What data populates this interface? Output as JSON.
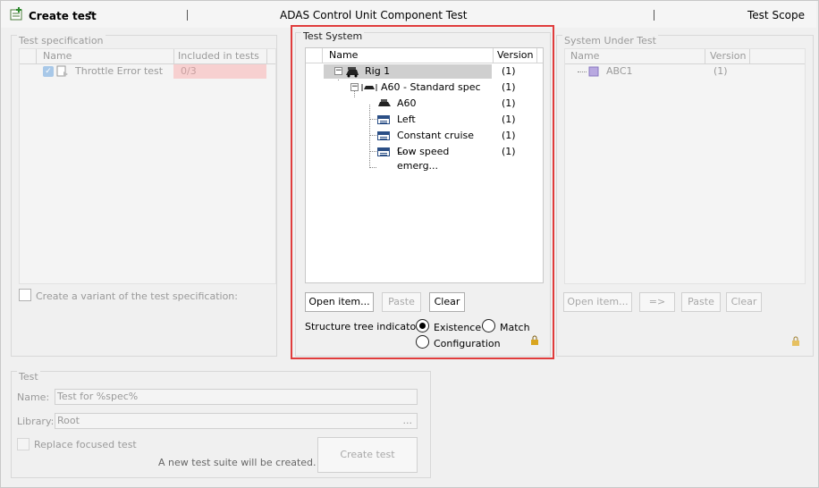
{
  "toolbar": {
    "create_test_label": "Create test",
    "title": "ADAS Control Unit Component Test",
    "scope_label": "Test Scope",
    "separator": "|"
  },
  "test_spec": {
    "title": "Test specification",
    "columns": [
      "Name",
      "Included in tests"
    ],
    "rows": [
      {
        "name": "Throttle Error test",
        "included": "0/3"
      }
    ],
    "variant_label": "Create a variant of the test specification:"
  },
  "test_system": {
    "title": "Test System",
    "columns": [
      "Name",
      "Version"
    ],
    "tree": [
      {
        "label": "Rig 1",
        "version": "(1)"
      },
      {
        "label": "A60 - Standard spec",
        "version": "(1)"
      },
      {
        "label": "A60",
        "version": "(1)"
      },
      {
        "label": "Left",
        "version": "(1)"
      },
      {
        "label": "Constant cruise c...",
        "version": "(1)"
      },
      {
        "label": "Low speed emerg...",
        "version": "(1)"
      }
    ],
    "buttons": {
      "open": "Open item...",
      "paste": "Paste",
      "clear": "Clear"
    },
    "indicator_label": "Structure tree indicator:",
    "indicator_options": [
      "Existence",
      "Match",
      "Configuration"
    ],
    "indicator_selected": "Existence",
    "expander_symbol": "−"
  },
  "sut": {
    "title": "System Under Test",
    "columns": [
      "Name",
      "Version"
    ],
    "rows": [
      {
        "name": "ABC1",
        "version": "(1)"
      }
    ],
    "buttons": {
      "open": "Open item...",
      "arrow": "=>",
      "paste": "Paste",
      "clear": "Clear"
    }
  },
  "test": {
    "title": "Test",
    "name_label": "Name:",
    "name_value": "Test for %spec%",
    "library_label": "Library:",
    "library_value": "Root",
    "library_browse": "...",
    "replace_label": "Replace focused test",
    "info": "A new test suite will be created.",
    "create_button": "Create test"
  },
  "colors": {
    "highlight": "#e03c3c",
    "selection": "#cfcfcf",
    "included_bg": "#f7d0d0"
  }
}
